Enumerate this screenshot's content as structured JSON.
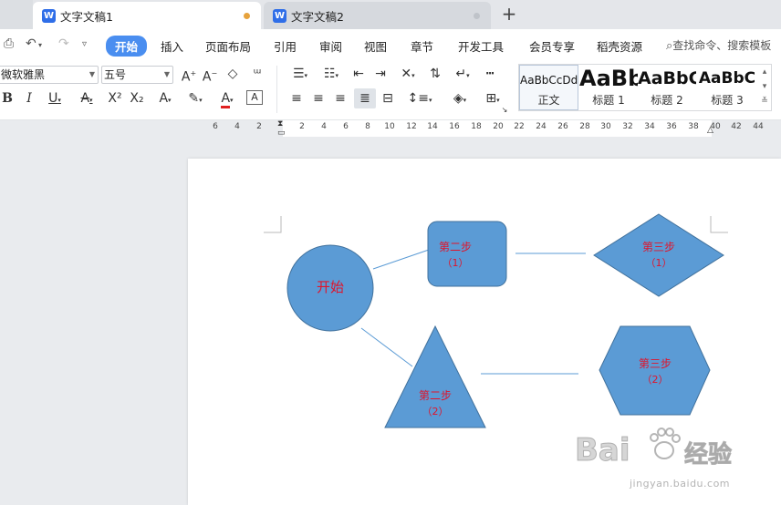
{
  "tabs": [
    {
      "label": "文字文稿1",
      "active": true,
      "dot_color": "#e6a23c"
    },
    {
      "label": "文字文稿2",
      "active": false,
      "dot_color": "#bfc3c9"
    }
  ],
  "menu": {
    "items": [
      "开始",
      "插入",
      "页面布局",
      "引用",
      "审阅",
      "视图",
      "章节",
      "开发工具",
      "会员专享",
      "稻壳资源"
    ],
    "active": "开始",
    "search_placeholder": "查找命令、搜索模板"
  },
  "ribbon": {
    "font_name": "微软雅黑",
    "font_size": "五号",
    "styles": [
      {
        "sample": "AaBbCcDd",
        "caption": "正文"
      },
      {
        "sample": "AaBb",
        "caption": "标题 1"
      },
      {
        "sample": "AaBbC",
        "caption": "标题 2"
      },
      {
        "sample": "AaBbC",
        "caption": "标题 3"
      }
    ]
  },
  "ruler": {
    "numbers": [
      "6",
      "4",
      "2",
      "2",
      "4",
      "6",
      "8",
      "10",
      "12",
      "14",
      "16",
      "18",
      "20",
      "22",
      "24",
      "26",
      "28",
      "30",
      "32",
      "34",
      "36",
      "38",
      "40",
      "42",
      "44"
    ]
  },
  "diagram": {
    "fill": "#5b9bd5",
    "stroke": "#41719c",
    "label_color": "#e0142b",
    "shapes": {
      "start": {
        "line1": "开始"
      },
      "step2a": {
        "line1": "第二步",
        "line2": "（1）"
      },
      "step3a": {
        "line1": "第三步",
        "line2": "（1）"
      },
      "step2b": {
        "line1": "第二步",
        "line2": "（2）"
      },
      "step3b": {
        "line1": "第三步",
        "line2": "（2）"
      }
    }
  },
  "watermark": {
    "brand_left": "Bai",
    "brand_right": "经验",
    "url": "jingyan.baidu.com"
  }
}
